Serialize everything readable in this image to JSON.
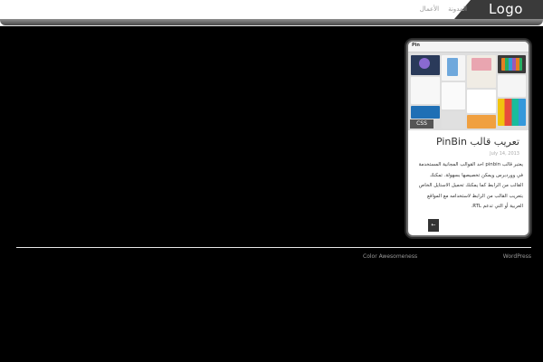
{
  "header": {
    "logo": "Logo",
    "nav": [
      {
        "label": "المدونة"
      },
      {
        "label": "الأعمال"
      }
    ]
  },
  "post": {
    "thumbnail_caption": "Pin",
    "thumbnail_badge": "CSS",
    "title": "تعريب قالب PinBin",
    "date": "July 14, 2013",
    "body": "يعتبر قالب pinbin احد القوالب المجانية المستخدمة في ووردبرس ويمكن تخصيصها بسهولة. تمكنك القالب من الرابط كما يمكنك تحميل الاستايل الخاص بتعريب القالب من الرابط لاستخدامه مع المواقع العربية أو التي تدعم RTL.",
    "more_button": "←"
  },
  "footer": {
    "left": "Color Awesomeness",
    "right": "WordPress"
  },
  "colors": {
    "background": "#000000",
    "header": "#ffffff",
    "logo_box": "#3a3a3a",
    "card": "#ffffff",
    "accent_dark": "#333333"
  }
}
